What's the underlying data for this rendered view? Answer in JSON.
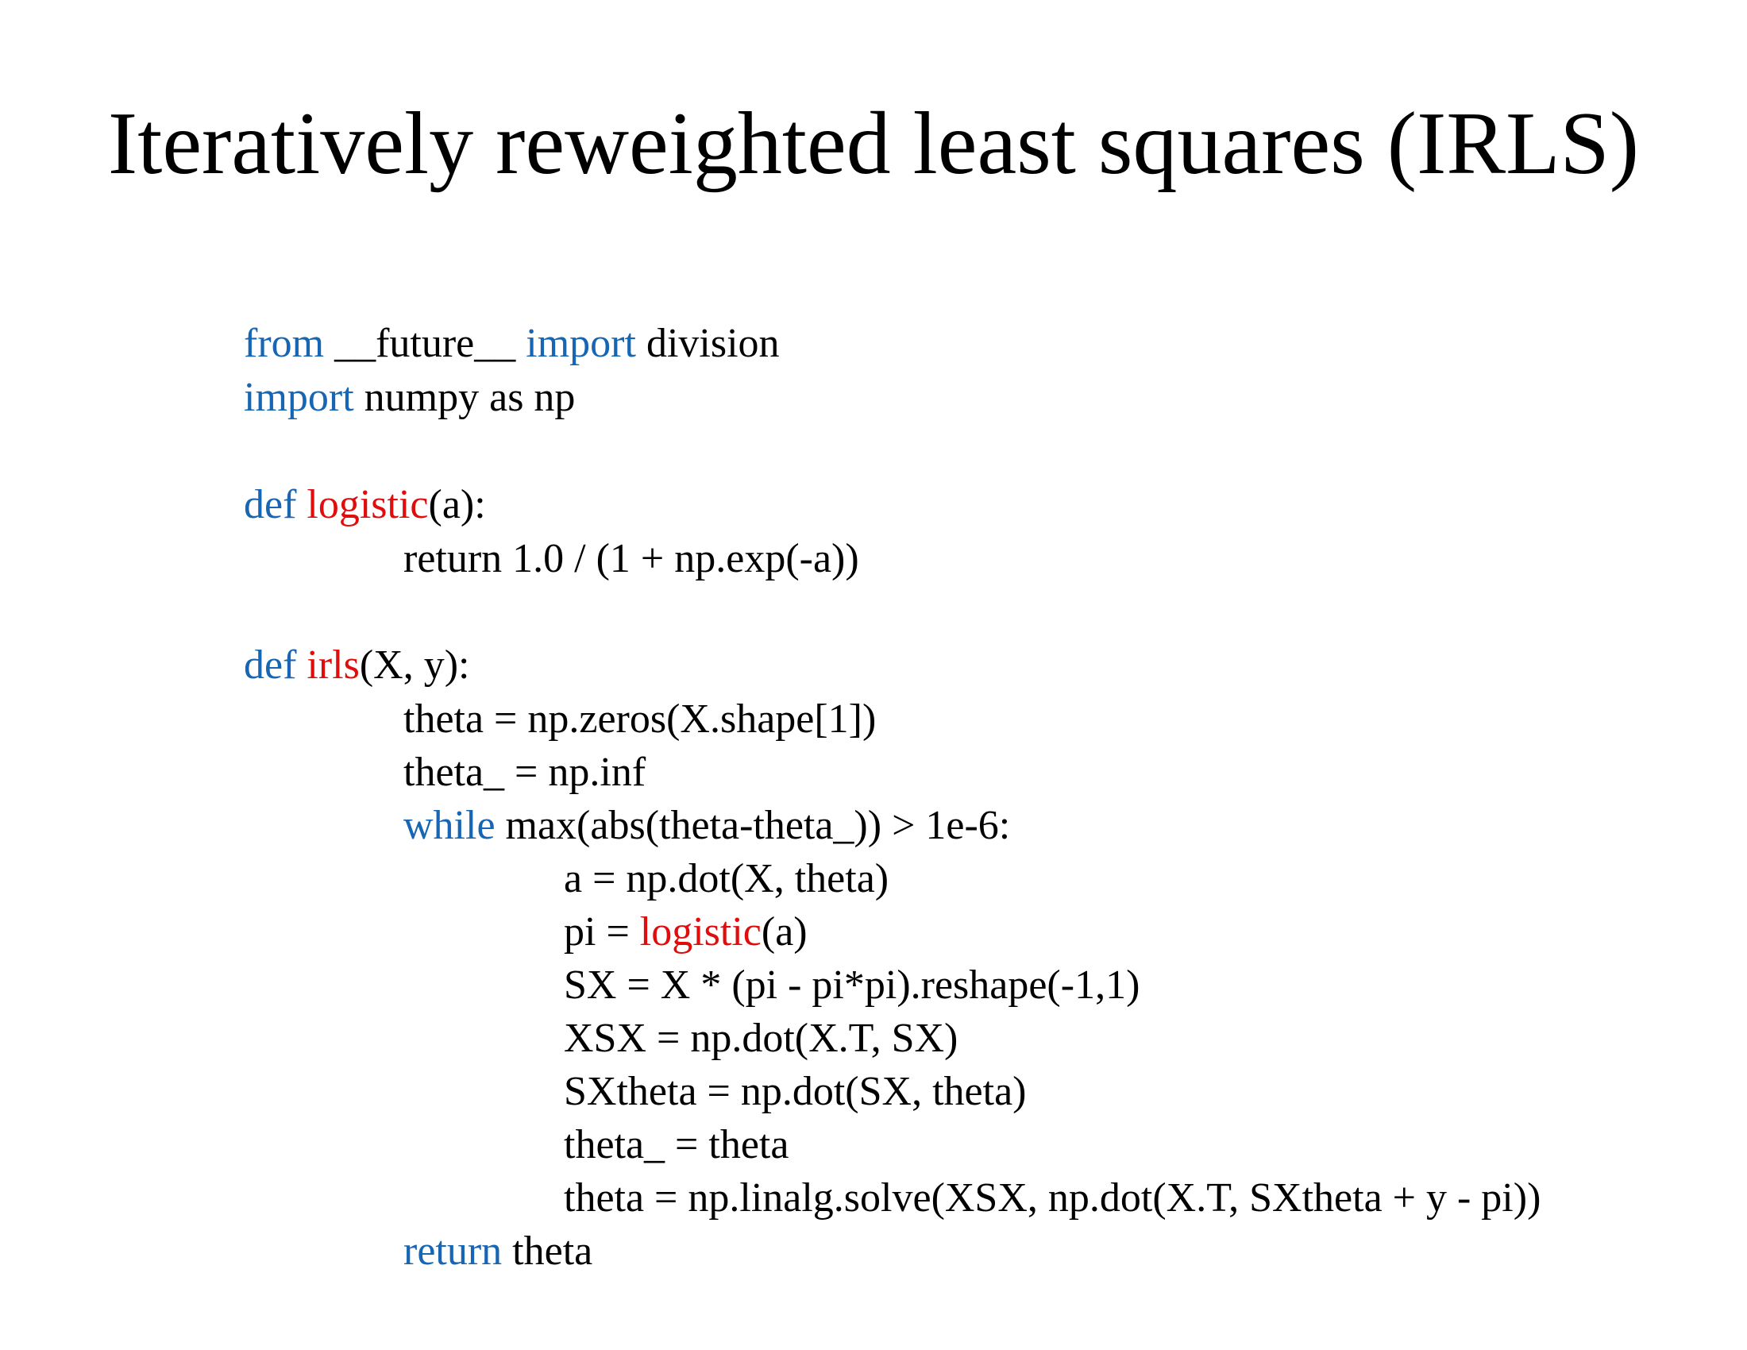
{
  "slide": {
    "title": "Iteratively reweighted least squares (IRLS)"
  },
  "colors": {
    "keyword": "#1666b3",
    "function_name": "#e00d0d",
    "text": "#000000",
    "background": "#ffffff"
  },
  "code": {
    "lines": [
      {
        "indent": 0,
        "tokens": [
          {
            "t": "from",
            "c": "keyword"
          },
          {
            "t": " __future__ ",
            "c": "text"
          },
          {
            "t": "import",
            "c": "keyword"
          },
          {
            "t": " division",
            "c": "text"
          }
        ]
      },
      {
        "indent": 0,
        "tokens": [
          {
            "t": "import",
            "c": "keyword"
          },
          {
            "t": " numpy as np",
            "c": "text"
          }
        ]
      },
      {
        "indent": 0,
        "tokens": [
          {
            "t": "def",
            "c": "keyword"
          },
          {
            "t": " ",
            "c": "text"
          },
          {
            "t": "logistic",
            "c": "function"
          },
          {
            "t": "(a):",
            "c": "text"
          }
        ]
      },
      {
        "indent": 1,
        "tokens": [
          {
            "t": "return 1.0 / (1 + np.exp(-a))",
            "c": "text"
          }
        ]
      },
      {
        "indent": 0,
        "tokens": [
          {
            "t": "def",
            "c": "keyword"
          },
          {
            "t": " ",
            "c": "text"
          },
          {
            "t": "irls",
            "c": "function"
          },
          {
            "t": "(X, y):",
            "c": "text"
          }
        ]
      },
      {
        "indent": 1,
        "tokens": [
          {
            "t": "theta = np.zeros(X.shape[1])",
            "c": "text"
          }
        ]
      },
      {
        "indent": 1,
        "tokens": [
          {
            "t": "theta_ = np.inf",
            "c": "text"
          }
        ]
      },
      {
        "indent": 1,
        "tokens": [
          {
            "t": "while",
            "c": "keyword"
          },
          {
            "t": " max(abs(theta-theta_)) > 1e-6:",
            "c": "text"
          }
        ]
      },
      {
        "indent": 2,
        "tokens": [
          {
            "t": "a = np.dot(X, theta)",
            "c": "text"
          }
        ]
      },
      {
        "indent": 2,
        "tokens": [
          {
            "t": "pi = ",
            "c": "text"
          },
          {
            "t": "logistic",
            "c": "function"
          },
          {
            "t": "(a)",
            "c": "text"
          }
        ]
      },
      {
        "indent": 2,
        "tokens": [
          {
            "t": "SX = X * (pi - pi*pi).reshape(-1,1)",
            "c": "text"
          }
        ]
      },
      {
        "indent": 2,
        "tokens": [
          {
            "t": "XSX = np.dot(X.T, SX)",
            "c": "text"
          }
        ]
      },
      {
        "indent": 2,
        "tokens": [
          {
            "t": "SXtheta = np.dot(SX, theta)",
            "c": "text"
          }
        ]
      },
      {
        "indent": 2,
        "tokens": [
          {
            "t": "theta_ = theta",
            "c": "text"
          }
        ]
      },
      {
        "indent": 2,
        "tokens": [
          {
            "t": "theta = np.linalg.solve(XSX, np.dot(X.T, SXtheta + y - pi))",
            "c": "text"
          }
        ]
      },
      {
        "indent": 1,
        "tokens": [
          {
            "t": "return",
            "c": "keyword"
          },
          {
            "t": " theta",
            "c": "text"
          }
        ]
      }
    ]
  }
}
